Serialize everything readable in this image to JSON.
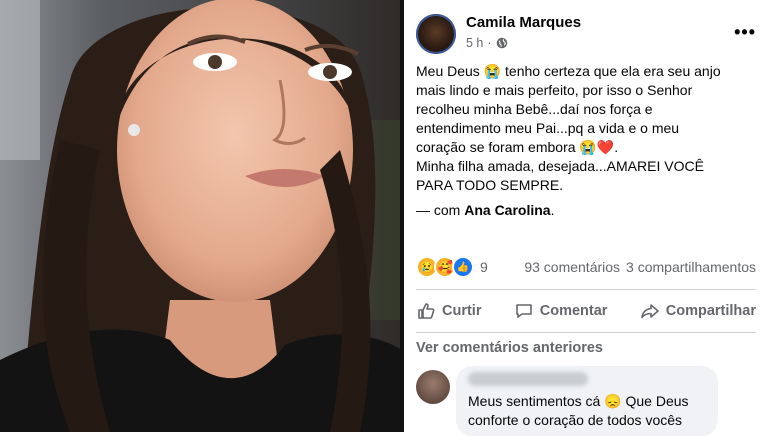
{
  "post": {
    "author": "Camila Marques",
    "time": "5 h",
    "more": "•••",
    "text_lines": [
      "Meu Deus 😭 tenho certeza que ela era seu anjo",
      "mais lindo e mais perfeito, por isso o Senhor",
      "recolheu minha Bebê...daí nos força e",
      "entendimento meu Pai...pq a vida e o meu",
      "coração se foram embora 😭❤️.",
      "Minha filha amada, desejada...AMAREI VOCÊ",
      "PARA TODO SEMPRE."
    ],
    "with_prefix": "— com",
    "with_name": "Ana Carolina",
    "with_suffix": "."
  },
  "reactions": {
    "icons": [
      "sad-reaction-icon",
      "care-reaction-icon",
      "like-reaction-icon"
    ],
    "count": "9",
    "comments": "93 comentários",
    "shares": "3 compartilhamentos"
  },
  "actions": {
    "like": "Curtir",
    "comment": "Comentar",
    "share": "Compartilhar"
  },
  "comments": {
    "previous": "Ver comentários anteriores",
    "first_text_line1": "Meus sentimentos cá 😞 Que Deus",
    "first_text_line2": "conforte o coração de todos vocês"
  },
  "colors": {
    "accent": "#1877f2",
    "secondary_text": "#65676b",
    "divider": "#ced0d4",
    "bubble": "#f0f2f5"
  }
}
